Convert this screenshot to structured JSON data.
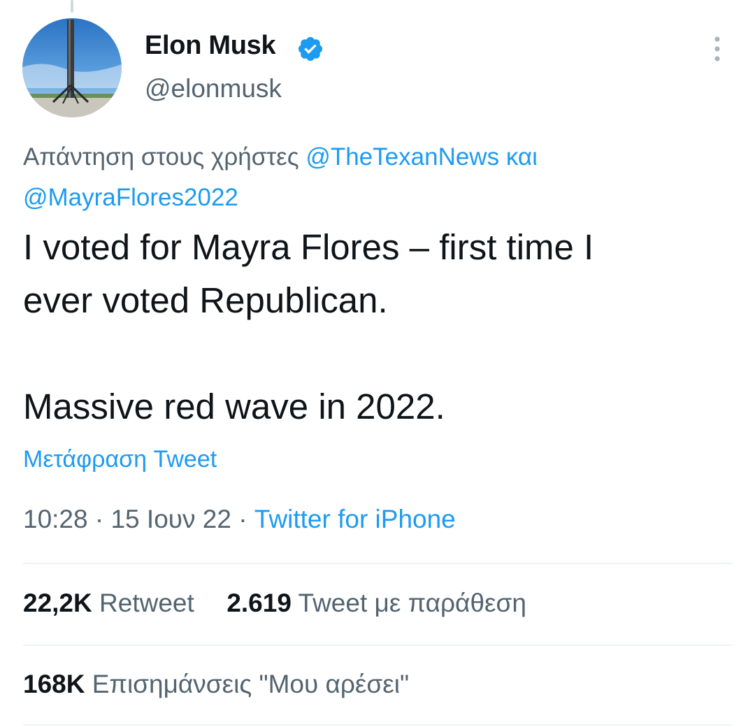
{
  "tweet": {
    "author": {
      "name": "Elon Musk",
      "handle": "@elonmusk",
      "verified": true,
      "avatar_icon": "rocket-avatar"
    },
    "reply_to": {
      "prefix": "Απάντηση στους χρήστες",
      "user1": "@TheTexanNews",
      "conjunction": "και",
      "user2": "@MayraFlores2022"
    },
    "text": "I voted for Mayra Flores – first time I\never voted Republican.\n\nMassive red wave in 2022.",
    "translate_label": "Μετάφραση Tweet",
    "time": "10:28",
    "separator": "·",
    "date": "15 Ιουν 22",
    "source": "Twitter for iPhone",
    "stats": {
      "retweets_count": "22,2K",
      "retweets_label": "Retweet",
      "quotes_count": "2.619",
      "quotes_label": "Tweet με παράθεση",
      "likes_count": "168K",
      "likes_label": "Επισημάνσεις \"Μου αρέσει\""
    }
  },
  "colors": {
    "accent": "#1d9bf0",
    "text": "#0f1419",
    "secondary_text": "#536471",
    "divider": "#eff3f4"
  },
  "icons": [
    "verified-badge-icon",
    "more-vertical-icon"
  ]
}
